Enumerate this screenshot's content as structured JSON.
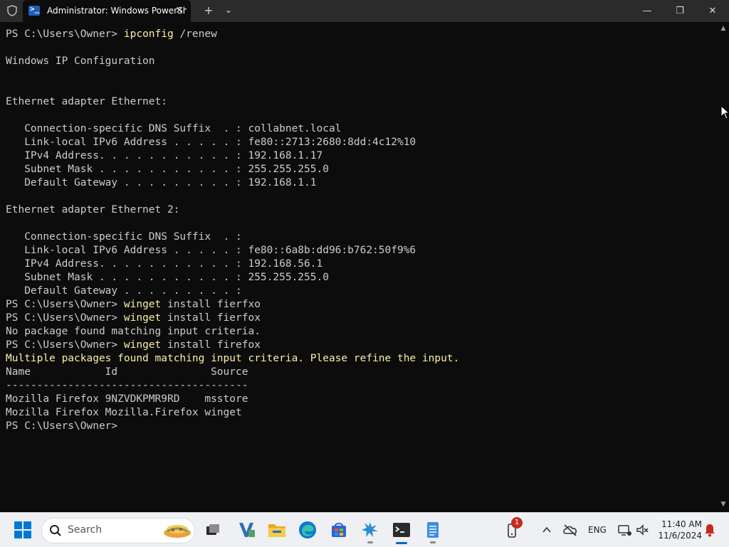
{
  "window": {
    "tab_title": "Administrator: Windows PowerShell",
    "tab_close": "✕",
    "new_tab": "+",
    "dropdown": "⌄",
    "minimize": "—",
    "maximize": "❐",
    "close": "✕"
  },
  "terminal": {
    "lines": [
      {
        "prompt": "PS C:\\Users\\Owner> ",
        "cmd": "ipconfig",
        "rest": " /renew"
      },
      {
        "text": ""
      },
      {
        "text": "Windows IP Configuration"
      },
      {
        "text": ""
      },
      {
        "text": ""
      },
      {
        "text": "Ethernet adapter Ethernet:"
      },
      {
        "text": ""
      },
      {
        "text": "   Connection-specific DNS Suffix  . : collabnet.local"
      },
      {
        "text": "   Link-local IPv6 Address . . . . . : fe80::2713:2680:8dd:4c12%10"
      },
      {
        "text": "   IPv4 Address. . . . . . . . . . . : 192.168.1.17"
      },
      {
        "text": "   Subnet Mask . . . . . . . . . . . : 255.255.255.0"
      },
      {
        "text": "   Default Gateway . . . . . . . . . : 192.168.1.1"
      },
      {
        "text": ""
      },
      {
        "text": "Ethernet adapter Ethernet 2:"
      },
      {
        "text": ""
      },
      {
        "text": "   Connection-specific DNS Suffix  . :"
      },
      {
        "text": "   Link-local IPv6 Address . . . . . : fe80::6a8b:dd96:b762:50f9%6"
      },
      {
        "text": "   IPv4 Address. . . . . . . . . . . : 192.168.56.1"
      },
      {
        "text": "   Subnet Mask . . . . . . . . . . . : 255.255.255.0"
      },
      {
        "text": "   Default Gateway . . . . . . . . . :"
      },
      {
        "prompt": "PS C:\\Users\\Owner> ",
        "cmd": "winget",
        "rest": " install fierfxo"
      },
      {
        "prompt": "PS C:\\Users\\Owner> ",
        "cmd": "winget",
        "rest": " install fierfox"
      },
      {
        "text": "No package found matching input criteria."
      },
      {
        "prompt": "PS C:\\Users\\Owner> ",
        "cmd": "winget",
        "rest": " install firefox"
      },
      {
        "warn": "Multiple packages found matching input criteria. Please refine the input."
      },
      {
        "text": "Name            Id               Source"
      },
      {
        "text": "---------------------------------------"
      },
      {
        "text": "Mozilla Firefox 9NZVDKPMR9RD    msstore"
      },
      {
        "text": "Mozilla Firefox Mozilla.Firefox winget"
      },
      {
        "prompt": "PS C:\\Users\\Owner> ",
        "cmd": "",
        "rest": ""
      }
    ]
  },
  "taskbar": {
    "search_label": "Search",
    "notification_count": "1",
    "language": "ENG",
    "time": "11:40 AM",
    "date": "11/6/2024",
    "icons": [
      "start-icon",
      "task-view-icon",
      "visual-studio-icon",
      "file-explorer-icon",
      "edge-icon",
      "store-icon",
      "vscode-insiders-icon",
      "terminal-icon",
      "notepad-icon"
    ]
  },
  "colors": {
    "terminal_bg": "#0c0c0c",
    "terminal_fg": "#cccccc",
    "command_color": "#f9f1a5",
    "taskbar_bg": "#eef0f4",
    "accent": "#0067c0"
  }
}
